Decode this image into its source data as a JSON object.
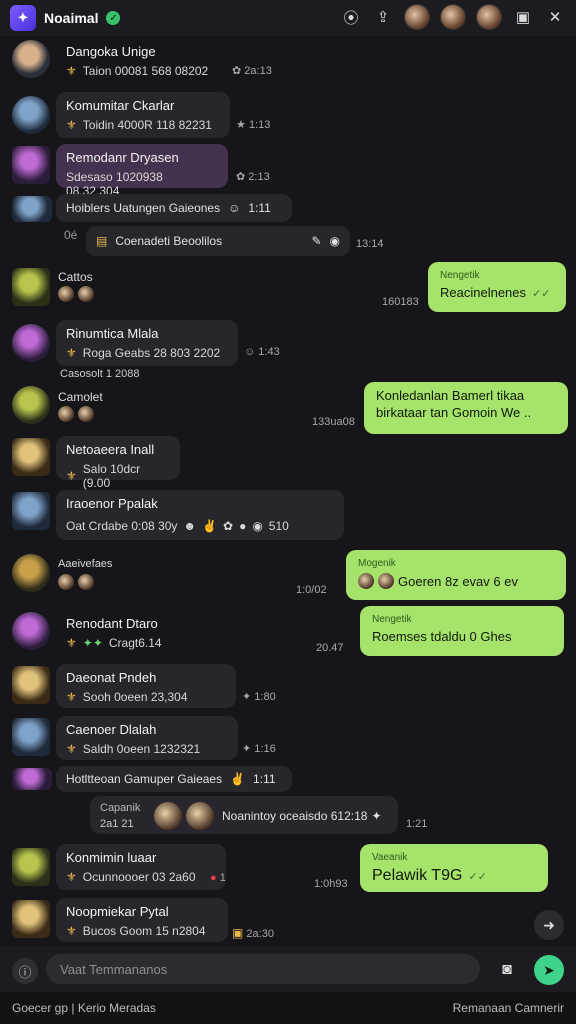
{
  "window": {
    "title": "Noaimal",
    "verified_icon": "check-circle-icon",
    "actions": [
      "compass-icon",
      "share-icon",
      "avatar",
      "avatar",
      "avatar",
      "maximize-icon",
      "close-icon"
    ]
  },
  "messages": {
    "m1": {
      "name": "Dangoka Unige",
      "sub": "Taion 00081 568 08202",
      "time": "2a:13"
    },
    "m2": {
      "name": "Komumitar Ckarlar",
      "sub": "Toidin 4000R 118 82231",
      "time": "1:13"
    },
    "m3": {
      "name": "Remodanr Dryasen",
      "sub": "Sdesaso 1020938 08.32.304",
      "time": "2:13"
    },
    "m4": {
      "text": "Hoiblers Uatungen Gaieones",
      "time": "1:11"
    },
    "m5": {
      "text": "Coenadeti Beoolilos",
      "time": "13:14",
      "prefix": "0é"
    },
    "m6": {
      "name": "Cattos"
    },
    "out1": {
      "label": "Nengetik",
      "text": "Reacinelnenes",
      "time": "160183"
    },
    "m7": {
      "name": "Rinumtica Mlala",
      "sub": "Roga Geabs 28 803 2202",
      "time": "1:43"
    },
    "m7b": {
      "text": "Casosolt 1 2088"
    },
    "m8": {
      "name": "Camolet"
    },
    "out2": {
      "text_line1": "Konledanlan Bamerl tikaa",
      "text_line2": "birkataar tan Gomoin We ..",
      "time": "133ua08"
    },
    "m9": {
      "name": "Netoaeera Inall",
      "sub": "Salo 10dcr (9.00"
    },
    "m10": {
      "name": "Iraoenor Ppalak",
      "sub": "Oat  Crdabe 0:08 30y",
      "time": "510"
    },
    "m11": {
      "name": "Aaeivefaes"
    },
    "out3": {
      "label": "Mogenik",
      "text": "Goeren 8z evav 6 ev",
      "time": "1:0/02"
    },
    "m12": {
      "name": "Renodant Dtaro",
      "sub": "Cragt6.14"
    },
    "out4": {
      "label": "Nengetik",
      "text": "Roemses tdaldu 0 Ghes",
      "time": "20.47"
    },
    "m13": {
      "name": "Daeonat Pndeh",
      "sub": "Sooh 0oeen 23,304",
      "time": "1:80"
    },
    "m14": {
      "name": "Caenoer Dlalah",
      "sub": "Saldh 0oeen 1232321",
      "time": "1:16"
    },
    "m15": {
      "text": "Hotltteoan Gamuper Gaieaes",
      "time": "1:11"
    },
    "m16": {
      "name": "Capanik",
      "time_small": "2a1 21",
      "text": "Noanintoy oceaisdo 612:18",
      "time": "1:21"
    },
    "m17": {
      "name": "Konmimin luaar",
      "sub": "Ocunnoooer 03 2a60",
      "time": "1"
    },
    "out5": {
      "label": "Vaeanik",
      "text": "Pelawik T9G",
      "time": "1:0h93"
    },
    "m18": {
      "name": "Noopmiekar Pytal",
      "sub": "Bucos Goom 15 n2804",
      "time": "2a:30"
    }
  },
  "composer": {
    "placeholder": "Vaat Temmananos",
    "attach_icon": "info-icon",
    "camera_icon": "camera-icon",
    "send_icon": "send-icon"
  },
  "footer": {
    "left": "Goecer gp  |  Kerio Meradas",
    "right": "Remanaan Camnerir"
  }
}
